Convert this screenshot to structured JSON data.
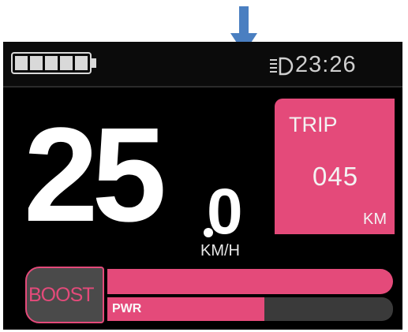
{
  "indicator": {
    "icon": "down-arrow-icon",
    "color": "#4a7fc1"
  },
  "status_bar": {
    "battery_icon": "battery-full-icon",
    "battery_segments_filled": 5,
    "battery_segments_total": 5,
    "headlight_icon": "headlight-icon",
    "time": "23:26"
  },
  "speed": {
    "integer": "25",
    "decimal": "0",
    "unit": "KM/H"
  },
  "trip": {
    "label": "TRIP",
    "value": "045",
    "unit": "KM"
  },
  "assist": {
    "boost_label": "BOOST",
    "pwr_label": "PWR",
    "pwr_level": 0.55
  },
  "colors": {
    "accent": "#e44a7a",
    "background": "#000000",
    "text": "#ffffff"
  }
}
